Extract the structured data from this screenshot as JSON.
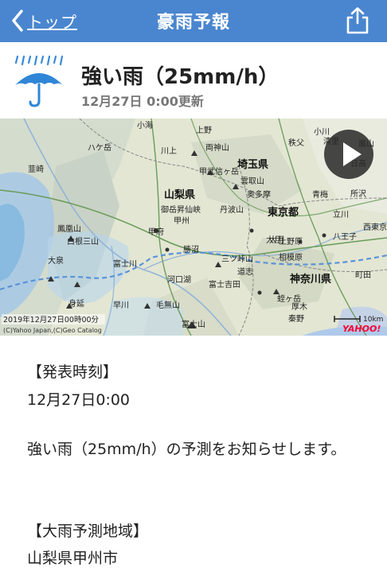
{
  "nav": {
    "back_label": "トップ",
    "title": "豪雨予報",
    "share_icon": "share-icon",
    "accent_color": "#4a86cf"
  },
  "alert": {
    "title": "強い雨（25mm/h）",
    "updated": "12月27日 0:00更新",
    "icon": "rain-umbrella-icon"
  },
  "map": {
    "prefectures": [
      "埼玉県",
      "山梨県",
      "東京都",
      "神奈川県"
    ],
    "places": [
      "上野",
      "両神山",
      "甲武信ヶ岳",
      "雲取山",
      "奥多摩",
      "青梅",
      "御岳昇仙峡",
      "甲州",
      "丹波山",
      "甲府",
      "勝沼",
      "大月",
      "上野原",
      "八王子",
      "相模原",
      "富士川",
      "三ツ峠山",
      "道志",
      "河口湖",
      "富士吉田",
      "丹沢山",
      "蛭ヶ岳",
      "厚木",
      "秦野",
      "毛無山",
      "富士山",
      "鳳凰山",
      "白根三山",
      "身延",
      "早川",
      "韮崎",
      "大泉",
      "小海",
      "八ヶ岳",
      "秩父",
      "小川",
      "東京都",
      "日高",
      "所沢",
      "立川",
      "町田",
      "相模湖",
      "大和",
      "西東京",
      "川上",
      "嵐山",
      "平塚",
      "上野",
      "清里"
    ],
    "timestamp": "2019年12月27日00時00分",
    "copyright": "(C)Yahoo Japan,(C)Geo Catalog",
    "scale": "10km",
    "logo": "YAHOO!",
    "play_icon": "play-icon"
  },
  "sections": {
    "issued_label": "【発表時刻】",
    "issued_value": "12月27日0:00",
    "message": "強い雨（25mm/h）の予測をお知らせします。",
    "area_label": "【大雨予測地域】",
    "area_value": "山梨県甲州市"
  }
}
